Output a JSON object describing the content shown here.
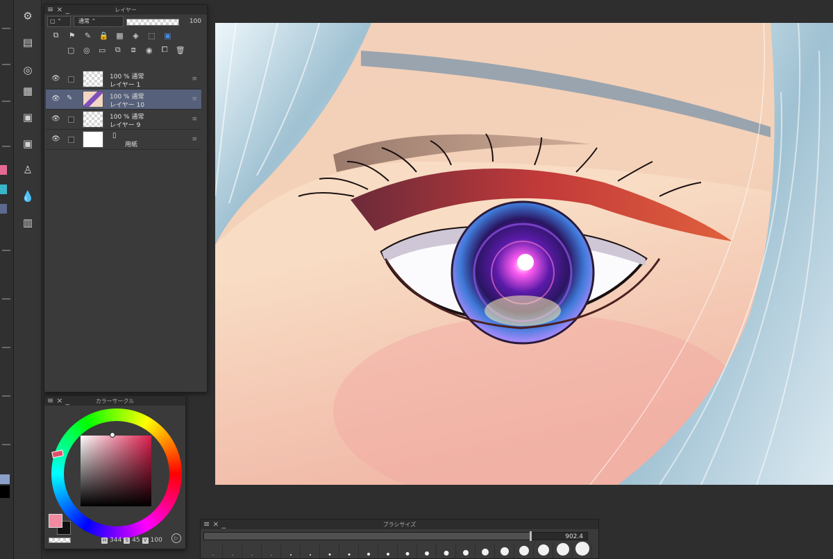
{
  "layer_panel": {
    "title": "レイヤー",
    "blend_mode": "通常",
    "opacity": "100",
    "layers": [
      {
        "opacity_mode": "100 % 通常",
        "name": "レイヤー 1",
        "selected": false
      },
      {
        "opacity_mode": "100 % 通常",
        "name": "レイヤー 10",
        "selected": true
      },
      {
        "opacity_mode": "100 % 通常",
        "name": "レイヤー 9",
        "selected": false
      },
      {
        "opacity_mode": "",
        "name": "用紙",
        "selected": false
      }
    ]
  },
  "color_panel": {
    "title": "カラーサークル",
    "h_label": "H",
    "h_value": "344",
    "s_label": "S",
    "s_value": "45",
    "v_label": "V",
    "v_value": "100",
    "main_color": "#ef8aa1",
    "sub_color": "#111111"
  },
  "brush_panel": {
    "title": "ブラシサイズ",
    "size_value": "902.4",
    "size_fraction": 0.85
  },
  "icons": {
    "eye": "eye-icon",
    "pen": "pen-icon",
    "menu": "menu-icon",
    "close": "close-icon"
  },
  "colors": {
    "accent_selected": "#56607a",
    "panel_bg": "#3a3a3a"
  }
}
